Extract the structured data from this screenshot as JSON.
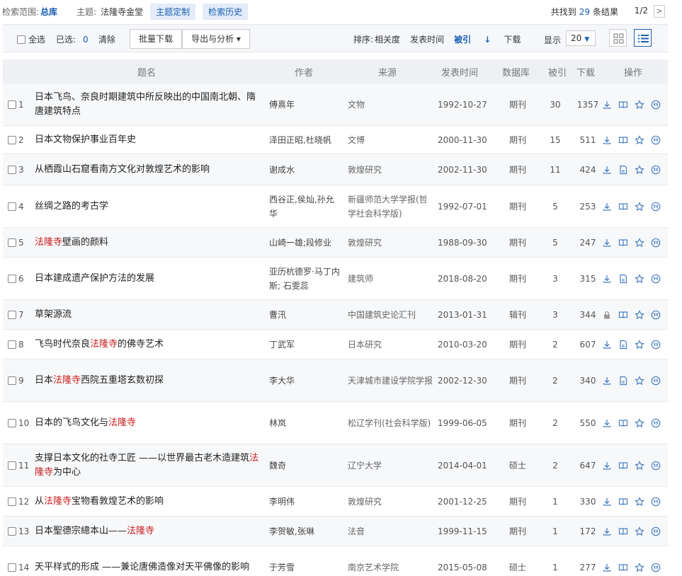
{
  "topbar": {
    "scope_label": "检索范围:",
    "scope_value": "总库",
    "topic_label": "主题:",
    "topic_value": "法隆寺金堂",
    "btn_custom": "主题定制",
    "btn_history": "检索历史",
    "found_prefix": "共找到",
    "found_count": "29",
    "found_suffix": "条结果",
    "page": "1/2",
    "next": ">"
  },
  "toolbar": {
    "select_all": "全选",
    "selected_label": "已选:",
    "selected_count": "0",
    "clear": "清除",
    "batch_download": "批量下载",
    "export": "导出与分析 ▾",
    "sort_label": "排序:",
    "sort_relevance": "相关度",
    "sort_date": "发表时间",
    "sort_cite": "被引",
    "sort_cite_arrow": "↓",
    "sort_download": "下载",
    "show_label": "显示",
    "page_size": "20"
  },
  "header": {
    "title": "题名",
    "author": "作者",
    "source": "来源",
    "date": "发表时间",
    "db": "数据库",
    "cite": "被引",
    "download": "下载",
    "ops": "操作"
  },
  "rows": [
    {
      "num": "1",
      "t1": "日本飞鸟、奈良时期建筑中所反映出的中国南北朝、隋唐建筑特点",
      "hl": "",
      "t2": "",
      "author": "傅熹年",
      "source": "文物",
      "date": "1992-10-27",
      "db": "期刊",
      "cite": "30",
      "dl": "1357"
    },
    {
      "num": "2",
      "t1": "日本文物保护事业百年史",
      "hl": "",
      "t2": "",
      "author": "泽田正昭,杜晓帆",
      "source": "文博",
      "date": "2000-11-30",
      "db": "期刊",
      "cite": "15",
      "dl": "511"
    },
    {
      "num": "3",
      "t1": "从栖霞山石窟看南方文化对敦煌艺术的影响",
      "hl": "",
      "t2": "",
      "author": "谢成水",
      "source": "敦煌研究",
      "date": "2002-11-30",
      "db": "期刊",
      "cite": "11",
      "dl": "424"
    },
    {
      "num": "4",
      "t1": "丝绸之路的考古学",
      "hl": "",
      "t2": "",
      "author": "西谷正,侯灿,孙允华",
      "source": "新疆师范大学学报(哲学社会科学版)",
      "date": "1992-07-01",
      "db": "期刊",
      "cite": "5",
      "dl": "253"
    },
    {
      "num": "5",
      "t1": "",
      "hl": "法隆寺",
      "t2": "壁画的颜料",
      "author": "山崎一雄;段修业",
      "source": "敦煌研究",
      "date": "1988-09-30",
      "db": "期刊",
      "cite": "5",
      "dl": "247"
    },
    {
      "num": "6",
      "t1": "日本建成遗产保护方法的发展",
      "hl": "",
      "t2": "",
      "author": "亚历杭德罗·马丁内斯; 石雯蕊",
      "source": "建筑师",
      "date": "2018-08-20",
      "db": "期刊",
      "cite": "3",
      "dl": "315"
    },
    {
      "num": "7",
      "t1": "草架源流",
      "hl": "",
      "t2": "",
      "author": "曹汛",
      "source": "中国建筑史论汇刊",
      "date": "2013-01-31",
      "db": "辑刊",
      "cite": "3",
      "dl": "344"
    },
    {
      "num": "8",
      "t1": "飞鸟时代奈良",
      "hl": "法隆寺",
      "t2": "的佛寺艺术",
      "author": "丁武军",
      "source": "日本研究",
      "date": "2010-03-20",
      "db": "期刊",
      "cite": "2",
      "dl": "607"
    },
    {
      "num": "9",
      "t1": "日本",
      "hl": "法隆寺",
      "t2": "西院五重塔玄数初探",
      "author": "李大华",
      "source": "天津城市建设学院学报",
      "date": "2002-12-30",
      "db": "期刊",
      "cite": "2",
      "dl": "340"
    },
    {
      "num": "10",
      "t1": "日本的飞鸟文化与",
      "hl": "法隆寺",
      "t2": "",
      "author": "林岚",
      "source": "松辽学刊(社会科学版)",
      "date": "1999-06-05",
      "db": "期刊",
      "cite": "2",
      "dl": "550"
    },
    {
      "num": "11",
      "t1": "支撑日本文化的社寺工匠 ——以世界最古老木造建筑",
      "hl": "法隆寺",
      "t2": "为中心",
      "author": "魏奇",
      "source": "辽宁大学",
      "date": "2014-04-01",
      "db": "硕士",
      "cite": "2",
      "dl": "647"
    },
    {
      "num": "12",
      "t1": "从",
      "hl": "法隆寺",
      "t2": "宝物看敦煌艺术的影响",
      "author": "李明伟",
      "source": "敦煌研究",
      "date": "2001-12-25",
      "db": "期刊",
      "cite": "1",
      "dl": "330"
    },
    {
      "num": "13",
      "t1": "日本聖德宗總本山——",
      "hl": "法隆寺",
      "t2": "",
      "author": "李贺敏,张琳",
      "source": "法音",
      "date": "1999-11-15",
      "db": "期刊",
      "cite": "1",
      "dl": "172"
    },
    {
      "num": "14",
      "t1": "天平样式的形成 ——兼论唐佛造像对天平佛像的影响",
      "hl": "",
      "t2": "",
      "author": "于芳雪",
      "source": "南京艺术学院",
      "date": "2015-05-08",
      "db": "硕士",
      "cite": "1",
      "dl": "277"
    }
  ]
}
